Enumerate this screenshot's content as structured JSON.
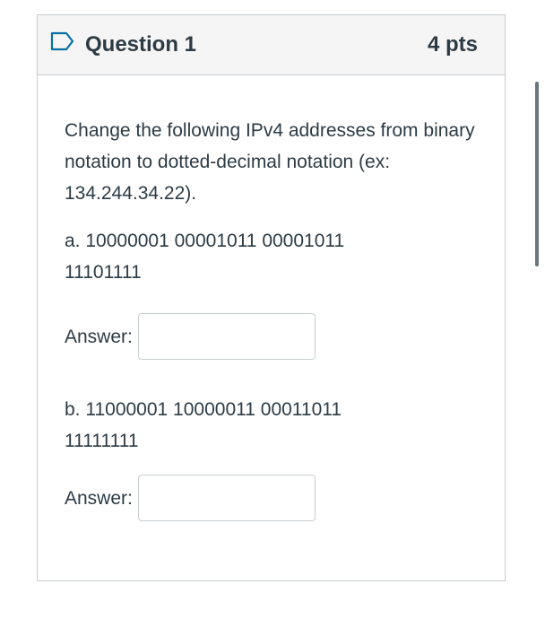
{
  "question": {
    "title": "Question 1",
    "points": "4 pts",
    "prompt": "Change the following IPv4 addresses from binary notation to dotted-decimal notation (ex: 134.244.34.22).",
    "items": [
      {
        "text_line1": "a. 10000001 00001011 00001011",
        "text_line2": "11101111",
        "answer_label": "Answer:",
        "answer_value": ""
      },
      {
        "text_line1": "b. 11000001 10000011 00011011",
        "text_line2": "11111111",
        "answer_label": "Answer:",
        "answer_value": ""
      }
    ]
  },
  "icons": {
    "flag": "bookmark-flag-icon"
  },
  "colors": {
    "flag_accent": "#0770a3",
    "text": "#2d3b45",
    "border": "#c7cdd1",
    "header_bg": "#f5f5f5"
  }
}
